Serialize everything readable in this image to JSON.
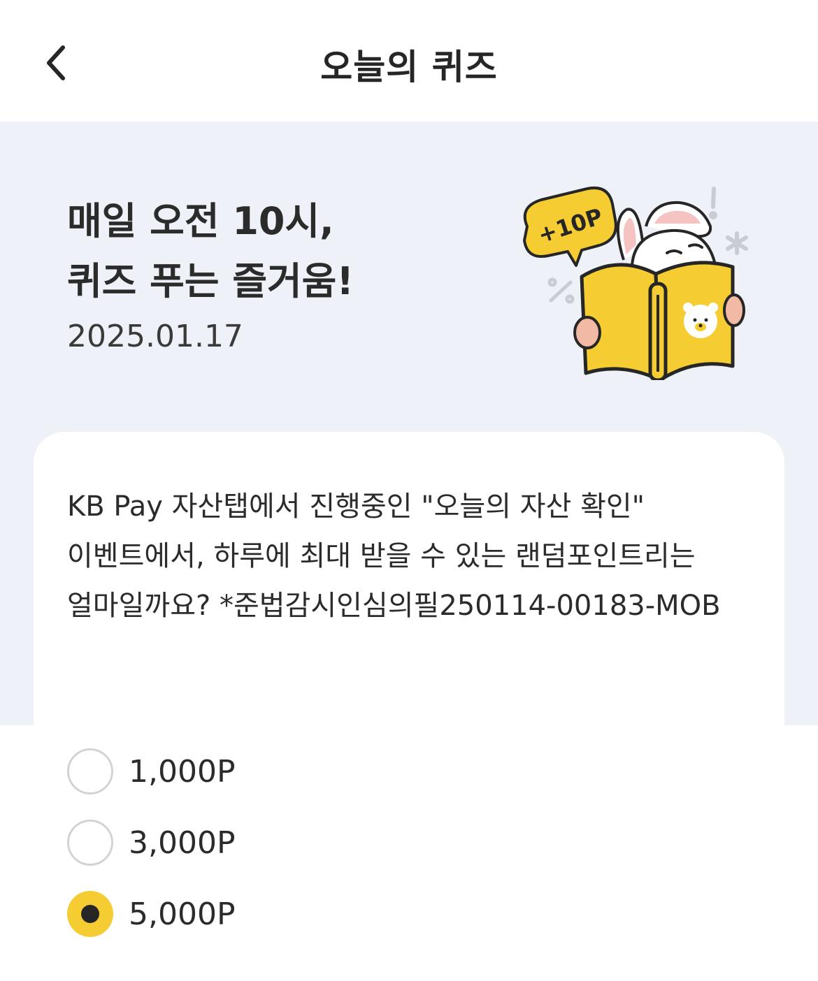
{
  "header": {
    "title": "오늘의 퀴즈",
    "back_icon": "chevron-left-icon"
  },
  "hero": {
    "headline_line1": "매일 오전 10시,",
    "headline_line2": "퀴즈 푸는 즐거움!",
    "date": "2025.01.17",
    "badge": "+10P",
    "accent_color": "#f6cc33",
    "background_color": "#eef1f7"
  },
  "quiz": {
    "question": "KB Pay 자산탭에서 진행중인 \"오늘의 자산 확인\" 이벤트에서, 하루에 최대 받을 수 있는 랜덤포인트리는 얼마일까요? *준법감시인심의필250114-00183-MOB",
    "options": [
      {
        "label": "1,000P",
        "selected": false
      },
      {
        "label": "3,000P",
        "selected": false
      },
      {
        "label": "5,000P",
        "selected": true
      }
    ],
    "selected_color": "#f6cc33"
  }
}
